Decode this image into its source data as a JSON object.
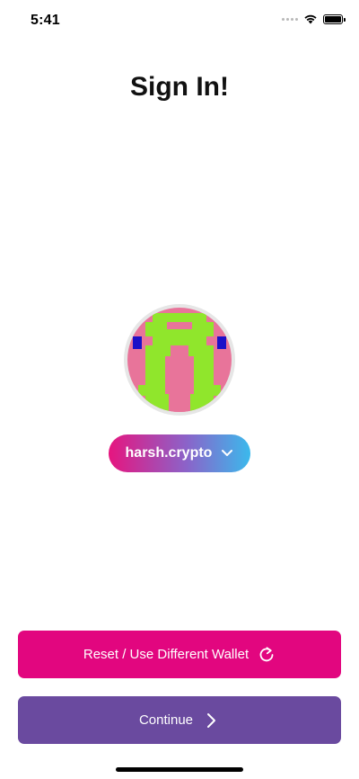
{
  "status_bar": {
    "time": "5:41",
    "icons": [
      "cellular-dots-icon",
      "wifi-icon",
      "battery-icon"
    ]
  },
  "page": {
    "title": "Sign In!"
  },
  "account": {
    "avatar_icon": "pixel-art-avatar",
    "domain": "harsh.crypto",
    "dropdown_icon": "chevron-down-icon"
  },
  "actions": {
    "reset_label": "Reset / Use Different Wallet",
    "reset_icon": "refresh-icon",
    "continue_label": "Continue",
    "continue_icon": "chevron-right-icon"
  },
  "colors": {
    "reset_button": "#e2067f",
    "continue_button": "#6a4a9f",
    "pill_gradient_start": "#e6157f",
    "pill_gradient_end": "#3bb9ec",
    "avatar_pink": "#e8749a",
    "avatar_green": "#90e62c",
    "avatar_blue": "#1c10c8"
  }
}
